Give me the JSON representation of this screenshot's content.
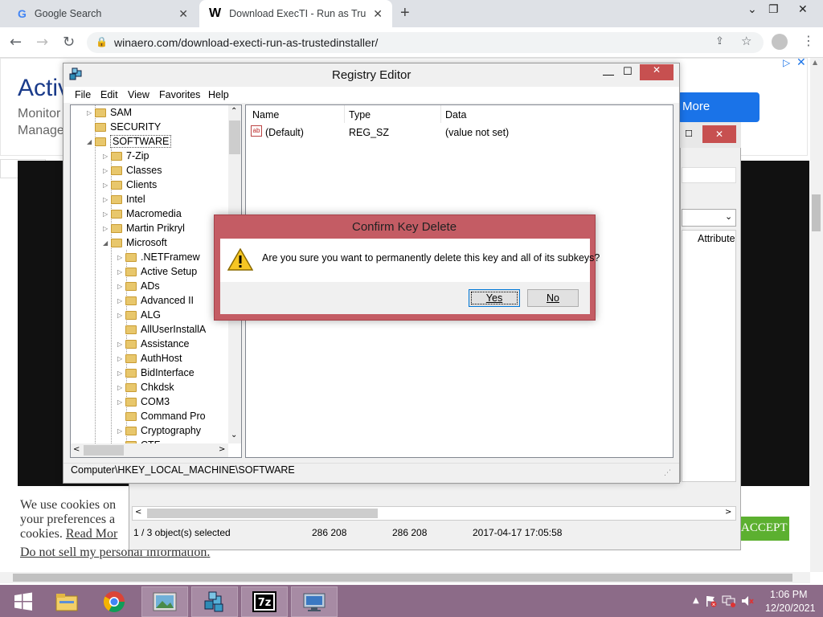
{
  "browser": {
    "tabs": [
      {
        "label": "Google Search",
        "icon": "google-icon"
      },
      {
        "label": "Download ExecTI - Run as Truste",
        "icon": "winaero-icon"
      }
    ],
    "url": "winaero.com/download-execti-run-as-trustedinstaller/"
  },
  "page": {
    "ad": {
      "title": "Activ",
      "line1": "Monitor",
      "line2": "Manage",
      "button": "More"
    },
    "cookie": {
      "line1": "We use cookies on",
      "line2": "your preferences a",
      "line3_text": "cookies.",
      "read_more": "Read Mor",
      "do_not_sell": "Do not sell my personal information",
      "accept": "ACCEPT"
    }
  },
  "bg_window": {
    "column": "Attribute",
    "status": {
      "selected": "1 / 3 object(s) selected",
      "size1": "286 208",
      "size2": "286 208",
      "date": "2017-04-17 17:05:58"
    }
  },
  "regedit": {
    "title": "Registry Editor",
    "menu": [
      "File",
      "Edit",
      "View",
      "Favorites",
      "Help"
    ],
    "tree": [
      {
        "label": "SAM",
        "level": 0
      },
      {
        "label": "SECURITY",
        "level": 0
      },
      {
        "label": "SOFTWARE",
        "level": 0,
        "selected": true
      },
      {
        "label": "7-Zip",
        "level": 1
      },
      {
        "label": "Classes",
        "level": 1
      },
      {
        "label": "Clients",
        "level": 1
      },
      {
        "label": "Intel",
        "level": 1
      },
      {
        "label": "Macromedia",
        "level": 1
      },
      {
        "label": "Martin Prikryl",
        "level": 1
      },
      {
        "label": "Microsoft",
        "level": 1
      },
      {
        "label": ".NETFramew",
        "level": 2
      },
      {
        "label": "Active Setup",
        "level": 2
      },
      {
        "label": "ADs",
        "level": 2
      },
      {
        "label": "Advanced II",
        "level": 2
      },
      {
        "label": "ALG",
        "level": 2
      },
      {
        "label": "AllUserInstallA",
        "level": 2
      },
      {
        "label": "Assistance",
        "level": 2
      },
      {
        "label": "AuthHost",
        "level": 2
      },
      {
        "label": "BidInterface",
        "level": 2
      },
      {
        "label": "Chkdsk",
        "level": 2
      },
      {
        "label": "COM3",
        "level": 2
      },
      {
        "label": "Command Pro",
        "level": 2
      },
      {
        "label": "Cryptography",
        "level": 2
      },
      {
        "label": "CTF",
        "level": 2
      }
    ],
    "columns": [
      "Name",
      "Type",
      "Data"
    ],
    "values": [
      {
        "name": "(Default)",
        "type": "REG_SZ",
        "data": "(value not set)"
      }
    ],
    "path": "Computer\\HKEY_LOCAL_MACHINE\\SOFTWARE"
  },
  "dialog": {
    "title": "Confirm Key Delete",
    "message": "Are you sure you want to permanently delete this key and all of its subkeys?",
    "yes": "Yes",
    "no": "No"
  },
  "taskbar": {
    "items": [
      "start-icon",
      "file-explorer-icon",
      "chrome-icon",
      "image-viewer-icon",
      "registry-editor-icon",
      "7zip-icon",
      "remote-desktop-icon"
    ],
    "time": "1:06 PM",
    "date": "12/20/2021"
  },
  "colors": {
    "taskbar": "#8c6b88",
    "dialog_frame": "#c45c64",
    "accept": "#5cb030",
    "ad_button": "#1a73e8"
  }
}
